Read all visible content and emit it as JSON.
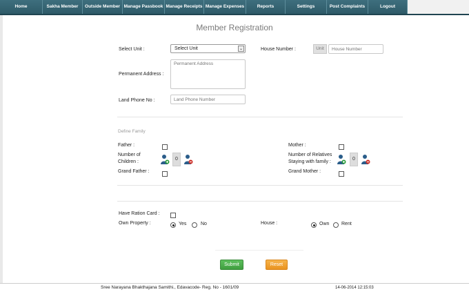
{
  "nav": {
    "items": [
      "Home",
      "Sakha Member",
      "Outside Member",
      "Manage Passbook",
      "Manage Receipts",
      "Manage Expenses",
      "Reports",
      "Settings",
      "Post Complaints",
      "Logout"
    ]
  },
  "page_title": "Member Registration",
  "form": {
    "select_unit_label": "Select Unit :",
    "select_unit_value": "Select Unit",
    "house_number_label": "House Number :",
    "unit_prefix": "Unit",
    "house_number_placeholder": "House Number",
    "permanent_address_label": "Permanent Address :",
    "permanent_address_placeholder": "Permanent Address",
    "land_phone_label": "Land Phone No :",
    "land_phone_placeholder": "Land Phone Number"
  },
  "family": {
    "section_title": "Define Family",
    "father_label": "Father :",
    "mother_label": "Mother :",
    "children_label_line1": "Number of",
    "children_label_line2": "Children :",
    "children_count": "0",
    "relatives_label_line1": "Number of Relatives",
    "relatives_label_line2": "Staying with family :",
    "relatives_count": "0",
    "grand_father_label": "Grand Father :",
    "grand_mother_label": "Grand Mother :"
  },
  "other": {
    "ration_card_label": "Have Ration Card :",
    "own_property_label": "Own Property :",
    "own_property_yes": "Yes",
    "own_property_no": "No",
    "house_label": "House :",
    "house_own": "Own",
    "house_rent": "Rent"
  },
  "buttons": {
    "submit": "Submit",
    "reset": "Reset"
  },
  "footer": {
    "org_text": "Sree Narayana Bhakthajana Samithi., Edavacode- Reg. No - 1601/09",
    "datetime": "14-06-2014 12:15:03"
  },
  "colors": {
    "nav": "#3a6a79",
    "submit": "#4cae4c",
    "reset": "#f0a030",
    "person_blue": "#2a5d8a",
    "plus_green": "#2e9e3e",
    "minus_red": "#d0342c"
  }
}
